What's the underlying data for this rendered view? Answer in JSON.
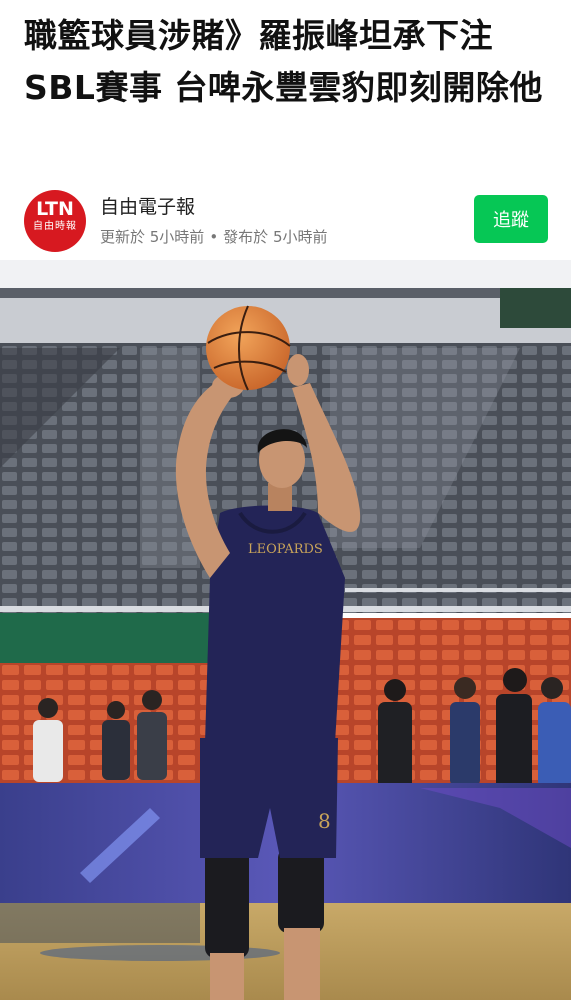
{
  "article": {
    "headline": "職籃球員涉賭》羅振峰坦承下注SBL賽事 台啤永豐雲豹即刻開除他"
  },
  "source": {
    "logo_text": "LTN",
    "logo_subtext": "自由時報",
    "publisher": "自由電子報",
    "updated": "更新於 5小時前",
    "separator": "•",
    "published": "發布於 5小時前",
    "follow_label": "追蹤"
  },
  "photo": {
    "jersey_text": "LEOPARDS",
    "shorts_number": "8"
  },
  "colors": {
    "follow_button": "#06c755",
    "logo_bg": "#d71920",
    "jersey": "#232457"
  }
}
